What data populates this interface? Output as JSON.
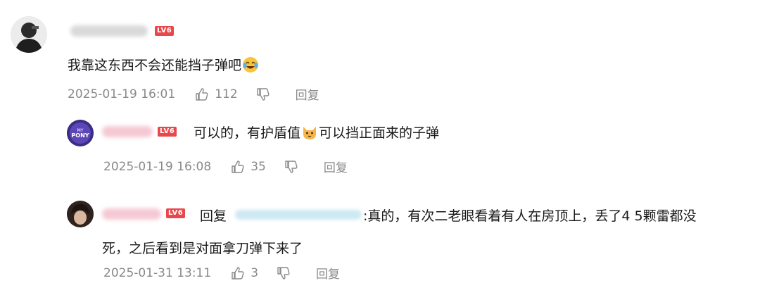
{
  "badge_color": "#e8484b",
  "comments": [
    {
      "level": "LV6",
      "text_before": "我靠这东西不会还能挡子弹吧",
      "emoji": "crying-laughing-emoji",
      "date": "2025-01-19 16:01",
      "likes": "112",
      "reply_label": "回复"
    },
    {
      "level": "LV6",
      "text_before": "可以的，有护盾值",
      "emoji": "cat-emoji",
      "text_after": "可以挡正面来的子弹",
      "date": "2025-01-19 16:08",
      "likes": "35",
      "reply_label": "回复"
    },
    {
      "level": "LV6",
      "reply_prefix": "回复",
      "line1": ":真的，有次二老眼看着有人在房顶上，丢了4 5颗雷都没",
      "line2": "死，之后看到是对面拿刀弹下来了",
      "date": "2025-01-31 13:11",
      "likes": "3",
      "reply_label": "回复"
    }
  ]
}
